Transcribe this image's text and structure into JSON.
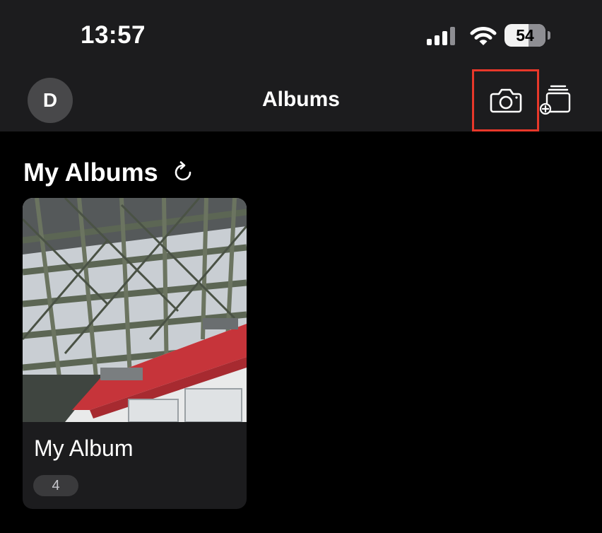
{
  "status_bar": {
    "time": "13:57",
    "battery_level": "54",
    "icons": [
      "cellular-signal-icon",
      "wifi-icon",
      "battery-icon"
    ]
  },
  "nav_bar": {
    "avatar_initial": "D",
    "title": "Albums",
    "camera_icon": "camera-icon",
    "add_album_icon": "add-album-icon"
  },
  "section": {
    "title": "My Albums",
    "refresh_icon": "refresh-icon"
  },
  "albums": [
    {
      "name": "My Album",
      "count": "4"
    }
  ],
  "colors": {
    "background": "#000000",
    "bar_background": "#1c1c1e",
    "card_background": "#1c1c1e",
    "highlight_border": "#e8382a",
    "badge_background": "#3a3a3c"
  }
}
